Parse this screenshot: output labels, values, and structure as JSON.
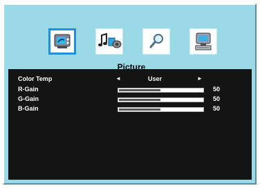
{
  "menu": {
    "title": "Picture",
    "tabs": [
      {
        "icon": "picture-tv-icon",
        "selected": true
      },
      {
        "icon": "audio-music-icon",
        "selected": false
      },
      {
        "icon": "magnifier-icon",
        "selected": false
      },
      {
        "icon": "computer-setup-icon",
        "selected": false
      }
    ]
  },
  "settings": {
    "color_temp": {
      "label": "Color Temp",
      "value": "User",
      "left_arrow": "◄",
      "right_arrow": "►"
    },
    "r_gain": {
      "label": "R-Gain",
      "value": "50",
      "fraction": 0.5
    },
    "g_gain": {
      "label": "G-Gain",
      "value": "50",
      "fraction": 0.5
    },
    "b_gain": {
      "label": "B-Gain",
      "value": "50",
      "fraction": 0.5
    }
  },
  "colors": {
    "background": "#9ad9e6",
    "panel": "#141414",
    "selected_border": "#1f90e0"
  }
}
